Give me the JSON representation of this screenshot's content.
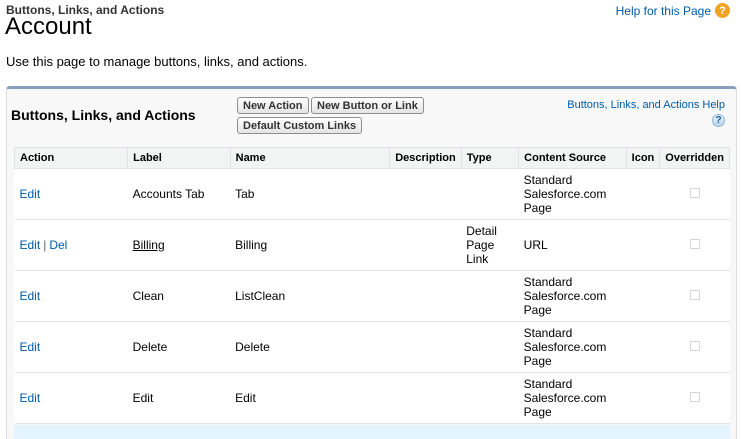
{
  "page": {
    "breadcrumb": "Buttons, Links, and Actions",
    "title": "Account",
    "help_link": "Help for this Page",
    "description": "Use this page to manage buttons, links, and actions."
  },
  "panel": {
    "title": "Buttons, Links, and Actions",
    "buttons": {
      "new_action": "New Action",
      "new_button_link": "New Button or Link",
      "default_custom_links": "Default Custom Links"
    },
    "help_link": "Buttons, Links, and Actions Help"
  },
  "table": {
    "columns": [
      "Action",
      "Label",
      "Name",
      "Description",
      "Type",
      "Content Source",
      "Icon",
      "Overridden"
    ],
    "rows": [
      {
        "actions": [
          "Edit"
        ],
        "label": "Accounts Tab",
        "name": "Tab",
        "description": "",
        "type": [
          "",
          "",
          ""
        ],
        "content_source": [
          "Standard",
          "Salesforce.com",
          "Page"
        ],
        "icon": "",
        "overridden": false
      },
      {
        "actions": [
          "Edit",
          "Del"
        ],
        "label": "Billing",
        "name": "Billing",
        "description": "",
        "type": [
          "Detail",
          "Page",
          "Link"
        ],
        "content_source": [
          "",
          "URL",
          ""
        ],
        "icon": "",
        "overridden": false
      },
      {
        "actions": [
          "Edit"
        ],
        "label": "Clean",
        "name": "ListClean",
        "description": "",
        "type": [
          "",
          "",
          ""
        ],
        "content_source": [
          "Standard",
          "Salesforce.com",
          "Page"
        ],
        "icon": "",
        "overridden": false
      },
      {
        "actions": [
          "Edit"
        ],
        "label": "Delete",
        "name": "Delete",
        "description": "",
        "type": [
          "",
          "",
          ""
        ],
        "content_source": [
          "Standard",
          "Salesforce.com",
          "Page"
        ],
        "icon": "",
        "overridden": false
      },
      {
        "actions": [
          "Edit"
        ],
        "label": "Edit",
        "name": "Edit",
        "description": "",
        "type": [
          "",
          "",
          ""
        ],
        "content_source": [
          "Standard",
          "Salesforce.com",
          "Page"
        ],
        "icon": "",
        "overridden": false
      }
    ]
  },
  "colors": {
    "link": "#015ba7",
    "panel_border": "#8a9ebe",
    "help_icon": "#f0a420",
    "row_highlight": "#e3f3ff"
  },
  "icons": [
    "help-question-icon",
    "help-question-icon-blue",
    "overridden-checkbox"
  ]
}
